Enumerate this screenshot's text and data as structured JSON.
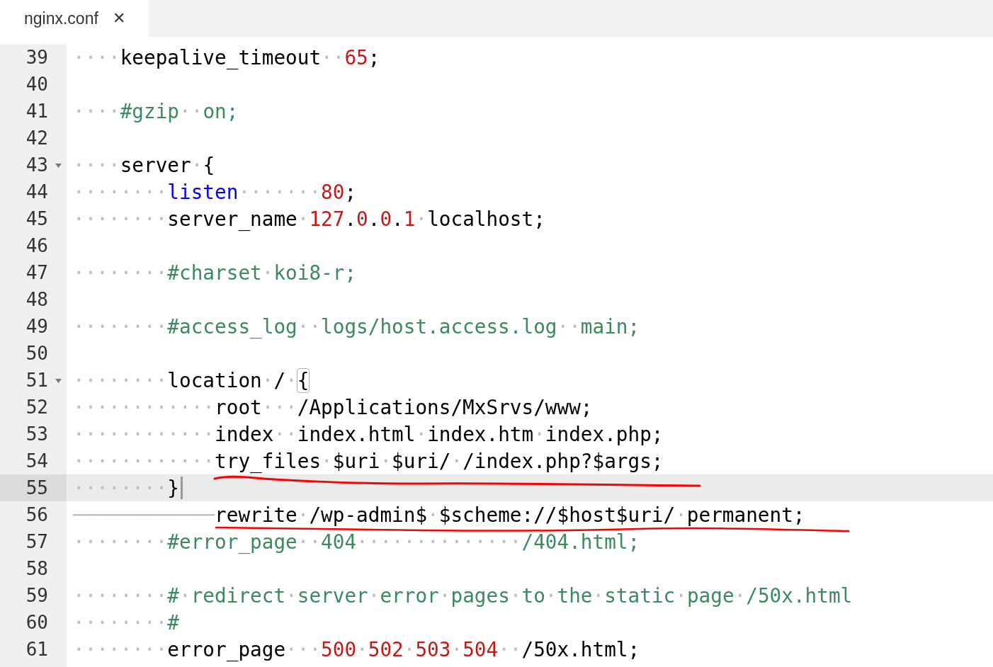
{
  "tab": {
    "title": "nginx.conf",
    "close": "✕",
    "selected": true
  },
  "lines": [
    {
      "number": "39",
      "tokens": [
        {
          "kind": "ws",
          "text": "····"
        },
        {
          "kind": "plain",
          "text": "keepalive_timeout"
        },
        {
          "kind": "ws",
          "text": "··"
        },
        {
          "kind": "number",
          "text": "65"
        },
        {
          "kind": "plain",
          "text": ";"
        }
      ]
    },
    {
      "number": "40"
    },
    {
      "number": "41",
      "tokens": [
        {
          "kind": "ws",
          "text": "····"
        },
        {
          "kind": "comment",
          "text": "#gzip"
        },
        {
          "kind": "ws",
          "text": "··"
        },
        {
          "kind": "comment",
          "text": "on;"
        }
      ]
    },
    {
      "number": "42"
    },
    {
      "number": "43",
      "foldable": true,
      "tokens": [
        {
          "kind": "ws",
          "text": "····"
        },
        {
          "kind": "plain",
          "text": "server"
        },
        {
          "kind": "ws",
          "text": "·"
        },
        {
          "kind": "plain",
          "text": "{"
        }
      ]
    },
    {
      "number": "44",
      "tokens": [
        {
          "kind": "ws",
          "text": "········"
        },
        {
          "kind": "keyword",
          "text": "listen"
        },
        {
          "kind": "ws",
          "text": "·······"
        },
        {
          "kind": "number",
          "text": "80"
        },
        {
          "kind": "plain",
          "text": ";"
        }
      ]
    },
    {
      "number": "45",
      "tokens": [
        {
          "kind": "ws",
          "text": "········"
        },
        {
          "kind": "plain",
          "text": "server_name"
        },
        {
          "kind": "ws",
          "text": "·"
        },
        {
          "kind": "number",
          "text": "127"
        },
        {
          "kind": "plain",
          "text": "."
        },
        {
          "kind": "number",
          "text": "0"
        },
        {
          "kind": "plain",
          "text": "."
        },
        {
          "kind": "number",
          "text": "0"
        },
        {
          "kind": "plain",
          "text": "."
        },
        {
          "kind": "number",
          "text": "1"
        },
        {
          "kind": "ws",
          "text": "·"
        },
        {
          "kind": "plain",
          "text": "localhost;"
        }
      ]
    },
    {
      "number": "46"
    },
    {
      "number": "47",
      "tokens": [
        {
          "kind": "ws",
          "text": "········"
        },
        {
          "kind": "comment",
          "text": "#charset"
        },
        {
          "kind": "ws",
          "text": "·"
        },
        {
          "kind": "comment",
          "text": "koi8-r;"
        }
      ]
    },
    {
      "number": "48"
    },
    {
      "number": "49",
      "tokens": [
        {
          "kind": "ws",
          "text": "········"
        },
        {
          "kind": "comment",
          "text": "#access_log"
        },
        {
          "kind": "ws",
          "text": "··"
        },
        {
          "kind": "comment",
          "text": "logs/host.access.log"
        },
        {
          "kind": "ws",
          "text": "··"
        },
        {
          "kind": "comment",
          "text": "main;"
        }
      ]
    },
    {
      "number": "50"
    },
    {
      "number": "51",
      "foldable": true,
      "tokens": [
        {
          "kind": "ws",
          "text": "········"
        },
        {
          "kind": "plain",
          "text": "location"
        },
        {
          "kind": "ws",
          "text": "·"
        },
        {
          "kind": "plain",
          "text": "/"
        },
        {
          "kind": "ws",
          "text": "·"
        },
        {
          "kind": "bracket_match",
          "text": "{"
        }
      ]
    },
    {
      "number": "52",
      "tokens": [
        {
          "kind": "ws",
          "text": "············"
        },
        {
          "kind": "plain",
          "text": "root"
        },
        {
          "kind": "ws",
          "text": "···"
        },
        {
          "kind": "plain",
          "text": "/Applications/MxSrvs/www;"
        }
      ]
    },
    {
      "number": "53",
      "tokens": [
        {
          "kind": "ws",
          "text": "············"
        },
        {
          "kind": "plain",
          "text": "index"
        },
        {
          "kind": "ws",
          "text": "··"
        },
        {
          "kind": "plain",
          "text": "index.html"
        },
        {
          "kind": "ws",
          "text": "·"
        },
        {
          "kind": "plain",
          "text": "index.htm"
        },
        {
          "kind": "ws",
          "text": "·"
        },
        {
          "kind": "plain",
          "text": "index.php;"
        }
      ]
    },
    {
      "number": "54",
      "tokens": [
        {
          "kind": "ws",
          "text": "············"
        },
        {
          "kind": "plain",
          "text": "try_files"
        },
        {
          "kind": "ws",
          "text": "·"
        },
        {
          "kind": "plain",
          "text": "$uri"
        },
        {
          "kind": "ws",
          "text": "·"
        },
        {
          "kind": "plain",
          "text": "$uri/"
        },
        {
          "kind": "ws",
          "text": "·"
        },
        {
          "kind": "plain",
          "text": "/index.php?$args;"
        }
      ]
    },
    {
      "number": "55",
      "current": true,
      "cursor": true,
      "tokens": [
        {
          "kind": "ws",
          "text": "········"
        },
        {
          "kind": "plain",
          "text": "}"
        }
      ]
    },
    {
      "number": "56",
      "tokens": [
        {
          "kind": "tab",
          "text": "────────────"
        },
        {
          "kind": "plain",
          "text": "rewrite"
        },
        {
          "kind": "ws",
          "text": "·"
        },
        {
          "kind": "plain",
          "text": "/wp-admin$"
        },
        {
          "kind": "ws",
          "text": "·"
        },
        {
          "kind": "plain",
          "text": "$scheme://$host$uri/"
        },
        {
          "kind": "ws",
          "text": "·"
        },
        {
          "kind": "plain",
          "text": "permanent;"
        }
      ]
    },
    {
      "number": "57",
      "tokens": [
        {
          "kind": "ws",
          "text": "········"
        },
        {
          "kind": "comment",
          "text": "#error_page"
        },
        {
          "kind": "ws",
          "text": "··"
        },
        {
          "kind": "comment",
          "text": "404"
        },
        {
          "kind": "ws",
          "text": "··············"
        },
        {
          "kind": "comment",
          "text": "/404.html;"
        }
      ]
    },
    {
      "number": "58"
    },
    {
      "number": "59",
      "tokens": [
        {
          "kind": "ws",
          "text": "········"
        },
        {
          "kind": "comment",
          "text": "#"
        },
        {
          "kind": "ws",
          "text": "·"
        },
        {
          "kind": "comment",
          "text": "redirect"
        },
        {
          "kind": "ws",
          "text": "·"
        },
        {
          "kind": "comment",
          "text": "server"
        },
        {
          "kind": "ws",
          "text": "·"
        },
        {
          "kind": "comment",
          "text": "error"
        },
        {
          "kind": "ws",
          "text": "·"
        },
        {
          "kind": "comment",
          "text": "pages"
        },
        {
          "kind": "ws",
          "text": "·"
        },
        {
          "kind": "comment",
          "text": "to"
        },
        {
          "kind": "ws",
          "text": "·"
        },
        {
          "kind": "comment",
          "text": "the"
        },
        {
          "kind": "ws",
          "text": "·"
        },
        {
          "kind": "comment",
          "text": "static"
        },
        {
          "kind": "ws",
          "text": "·"
        },
        {
          "kind": "comment",
          "text": "page"
        },
        {
          "kind": "ws",
          "text": "·"
        },
        {
          "kind": "comment",
          "text": "/50x.html"
        }
      ]
    },
    {
      "number": "60",
      "tokens": [
        {
          "kind": "ws",
          "text": "········"
        },
        {
          "kind": "comment",
          "text": "#"
        }
      ]
    },
    {
      "number": "61",
      "tokens": [
        {
          "kind": "ws",
          "text": "········"
        },
        {
          "kind": "plain",
          "text": "error_page"
        },
        {
          "kind": "ws",
          "text": "···"
        },
        {
          "kind": "number",
          "text": "500"
        },
        {
          "kind": "ws",
          "text": "·"
        },
        {
          "kind": "number",
          "text": "502"
        },
        {
          "kind": "ws",
          "text": "·"
        },
        {
          "kind": "number",
          "text": "503"
        },
        {
          "kind": "ws",
          "text": "·"
        },
        {
          "kind": "number",
          "text": "504"
        },
        {
          "kind": "ws",
          "text": "··"
        },
        {
          "kind": "plain",
          "text": "/50x.html;"
        }
      ]
    }
  ]
}
